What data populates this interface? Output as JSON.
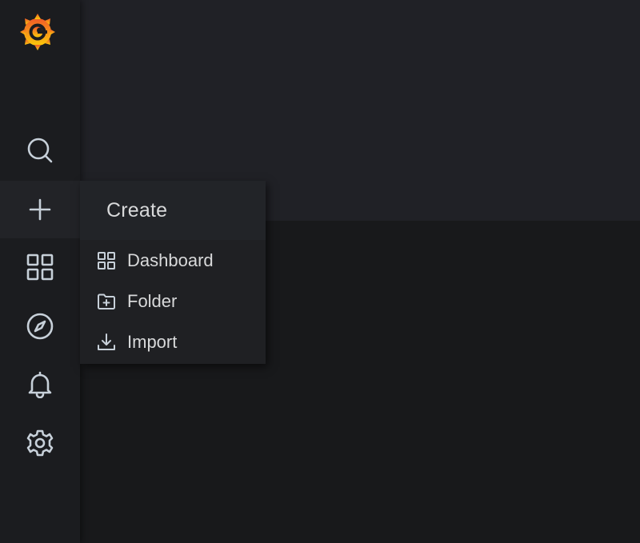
{
  "sidemenu": {
    "logo_name": "grafana-logo",
    "items": [
      {
        "name": "search",
        "icon": "search-icon"
      },
      {
        "name": "create",
        "icon": "plus-icon"
      },
      {
        "name": "dashboards",
        "icon": "apps-icon"
      },
      {
        "name": "explore",
        "icon": "compass-icon"
      },
      {
        "name": "alerting",
        "icon": "bell-icon"
      },
      {
        "name": "configuration",
        "icon": "gear-icon"
      }
    ]
  },
  "create_menu": {
    "title": "Create",
    "items": [
      {
        "label": "Dashboard",
        "icon": "apps-icon"
      },
      {
        "label": "Folder",
        "icon": "folder-plus-icon"
      },
      {
        "label": "Import",
        "icon": "import-icon"
      }
    ]
  },
  "colors": {
    "sidebar_bg": "#1b1c1f",
    "active_item_bg": "#222327",
    "menu_bg": "#1f2023",
    "text": "#d8d9da",
    "icon": "#c7d0d9",
    "logo_orange": "#f46800",
    "logo_yellow": "#fbca0a"
  }
}
